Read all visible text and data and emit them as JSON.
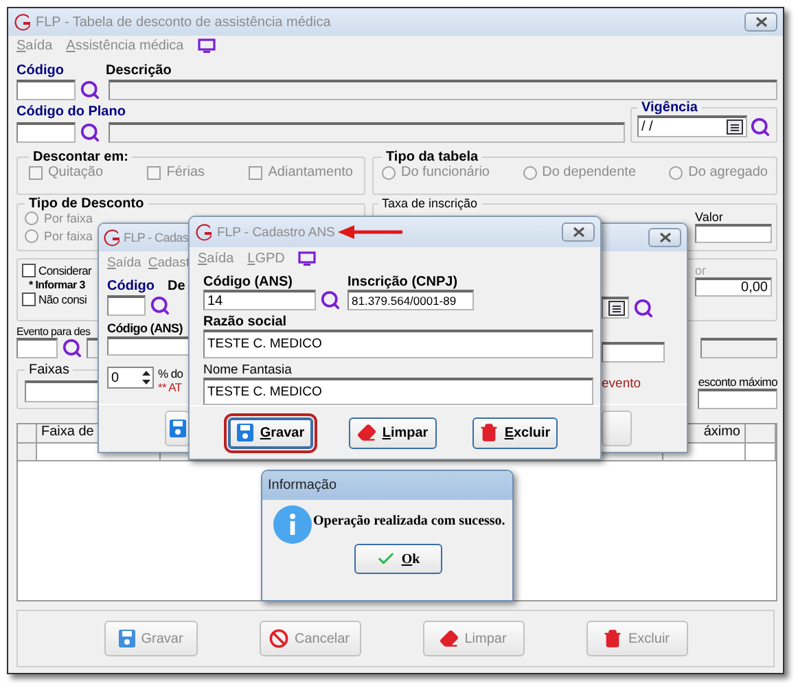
{
  "main_window": {
    "title": "FLP - Tabela de desconto de assistência médica",
    "menu": [
      "Saída",
      "Assistência médica"
    ],
    "codigo_label": "Código",
    "descricao_label": "Descrição",
    "codigo_plano_label": "Código do Plano",
    "vigencia": {
      "label": "Vigência",
      "value": "/ /"
    },
    "descontar_em": {
      "label": "Descontar em:",
      "disabled": true,
      "options": [
        {
          "label": "Quitação",
          "checked": false
        },
        {
          "label": "Férias",
          "checked": false
        },
        {
          "label": "Adiantamento",
          "checked": false
        }
      ]
    },
    "tipo_tabela": {
      "label": "Tipo da tabela",
      "disabled": true,
      "options": [
        {
          "label": "Do funcionário",
          "selected": false
        },
        {
          "label": "Do dependente",
          "selected": false
        },
        {
          "label": "Do agregado",
          "selected": false
        }
      ]
    },
    "tipo_desconto": {
      "label": "Tipo de Desconto",
      "disabled": true,
      "options": [
        {
          "label": "Por faixa",
          "selected": false
        },
        {
          "label": "Por faixa",
          "selected": false
        }
      ]
    },
    "taxa_inscricao": {
      "label": "Taxa de inscrição",
      "valor_label": "Valor"
    },
    "opcoes": [
      {
        "kind": "checkbox",
        "label": "Considerar",
        "checked": false
      },
      {
        "kind": "note",
        "label": "* Informar 3"
      },
      {
        "kind": "checkbox",
        "label": "Não consi",
        "checked": false
      }
    ],
    "valor_group": {
      "label": "or",
      "value": "0,00"
    },
    "evento_label": "Evento para des",
    "faixas_label": "Faixas",
    "desconto_maximo_label": "esconto máximo",
    "table": {
      "columns": [
        "Faixa de",
        "áximo"
      ]
    },
    "buttons": [
      {
        "label": "Gravar",
        "kind": "save",
        "disabled": true
      },
      {
        "label": "Cancelar",
        "kind": "cancel",
        "disabled": true
      },
      {
        "label": "Limpar",
        "kind": "eraser",
        "disabled": true
      },
      {
        "label": "Excluir",
        "kind": "delete",
        "disabled": true
      }
    ]
  },
  "back_window": {
    "title": "FLP - Cadas",
    "menu": [
      "Saída",
      "Cadast"
    ],
    "codigo_label": "Código",
    "descricao_label": "De",
    "codigo_ans_label": "Código (ANS)",
    "spinner_value": "0",
    "percent_label": "% do",
    "warning": "** AT",
    "warning_tail": "evento"
  },
  "front_window": {
    "title": "FLP - Cadastro ANS",
    "menu": [
      "Saída",
      "LGPD"
    ],
    "codigo_ans": {
      "label": "Código (ANS)",
      "value": "14"
    },
    "inscricao": {
      "label": "Inscrição (CNPJ)",
      "value": "81.379.564/0001-89"
    },
    "razao_social": {
      "label": "Razão social",
      "value": "TESTE C. MEDICO"
    },
    "nome_fantasia": {
      "label": "Nome Fantasia",
      "value": "TESTE C. MEDICO"
    },
    "buttons": [
      {
        "label": "Gravar",
        "kind": "save",
        "focused": true
      },
      {
        "label": "Limpar",
        "kind": "eraser",
        "focused": false
      },
      {
        "label": "Excluir",
        "kind": "delete",
        "focused": false
      }
    ]
  },
  "dialog": {
    "title": "Informação",
    "message": "Operação realizada com sucesso.",
    "button": "Ok"
  }
}
